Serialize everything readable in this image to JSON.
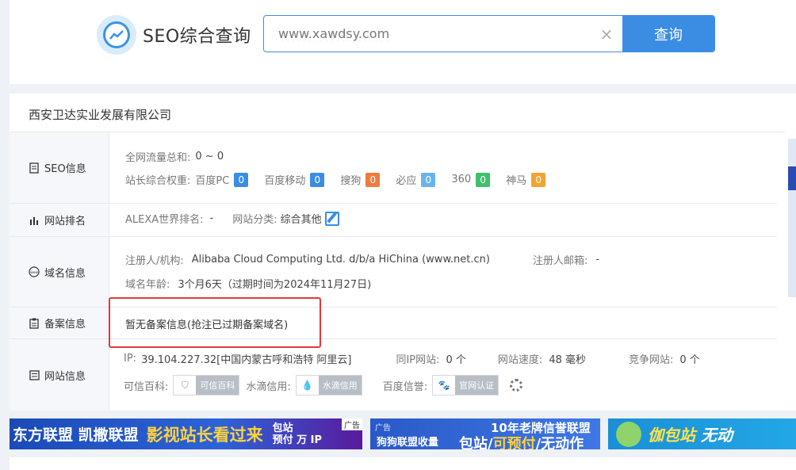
{
  "header": {
    "logo_text": "SEO综合查询",
    "search_value": "www.xawdsy.com",
    "clear_icon": "×",
    "search_button": "查询"
  },
  "company": "西安卫达实业发展有限公司",
  "seo": {
    "label": "SEO信息",
    "traffic_label": "全网流量总和:",
    "traffic_value": "0 ~ 0",
    "weight_label": "站长综合权重:",
    "weights": [
      {
        "name": "百度PC",
        "value": "0",
        "color": "#3b8de4"
      },
      {
        "name": "百度移动",
        "value": "0",
        "color": "#3b8de4"
      },
      {
        "name": "搜狗",
        "value": "0",
        "color": "#f07b3f"
      },
      {
        "name": "必应",
        "value": "0",
        "color": "#67b4f0"
      },
      {
        "name": "360",
        "value": "0",
        "color": "#3fbf6d"
      },
      {
        "name": "神马",
        "value": "0",
        "color": "#f3a332"
      }
    ]
  },
  "rank": {
    "label": "网站排名",
    "alexa_label": "ALEXA世界排名:",
    "alexa_value": "-",
    "category_label": "网站分类:",
    "category_value": "综合其他"
  },
  "domain": {
    "label": "域名信息",
    "registrar_label": "注册人/机构:",
    "registrar_value": "Alibaba Cloud Computing Ltd. d/b/a HiChina (www.net.cn)",
    "email_label": "注册人邮箱:",
    "email_value": "-",
    "age_label": "域名年龄:",
    "age_value": "3个月6天（过期时间为2024年11月27日)"
  },
  "icp": {
    "label": "备案信息",
    "value": "暂无备案信息(抢注已过期备案域名)"
  },
  "site": {
    "label": "网站信息",
    "ip_label": "IP:",
    "ip_value": "39.104.227.32[中国内蒙古呼和浩特 阿里云]",
    "same_ip_label": "同IP网站:",
    "same_ip_value": "0 个",
    "speed_label": "网站速度:",
    "speed_value": "48 毫秒",
    "compete_label": "竞争网站:",
    "compete_value": "0 个",
    "trust_label": "可信百科:",
    "trust_badge": "可信百科",
    "drop_label": "水滴信用:",
    "drop_badge": "水滴信用",
    "baidu_label": "百度信誉:",
    "baidu_badge": "官网认证"
  },
  "ads": {
    "ad1_text1": "东方联盟 凯撒联盟",
    "ad1_text2": "影视站长看过来",
    "ad1_stack1": "包站",
    "ad1_stack2": "预付 万 IP",
    "ad1_tag": "广告",
    "ad2_tag": "广告",
    "ad2_left": "狗狗联盟收量",
    "ad2_right1": "10年老牌信誉联盟",
    "ad2_right2_a": "包站/",
    "ad2_right2_b": "可预付",
    "ad2_right2_c": "/无动作",
    "ad3_text_a": "伽包站",
    "ad3_text_b": " 无动"
  }
}
